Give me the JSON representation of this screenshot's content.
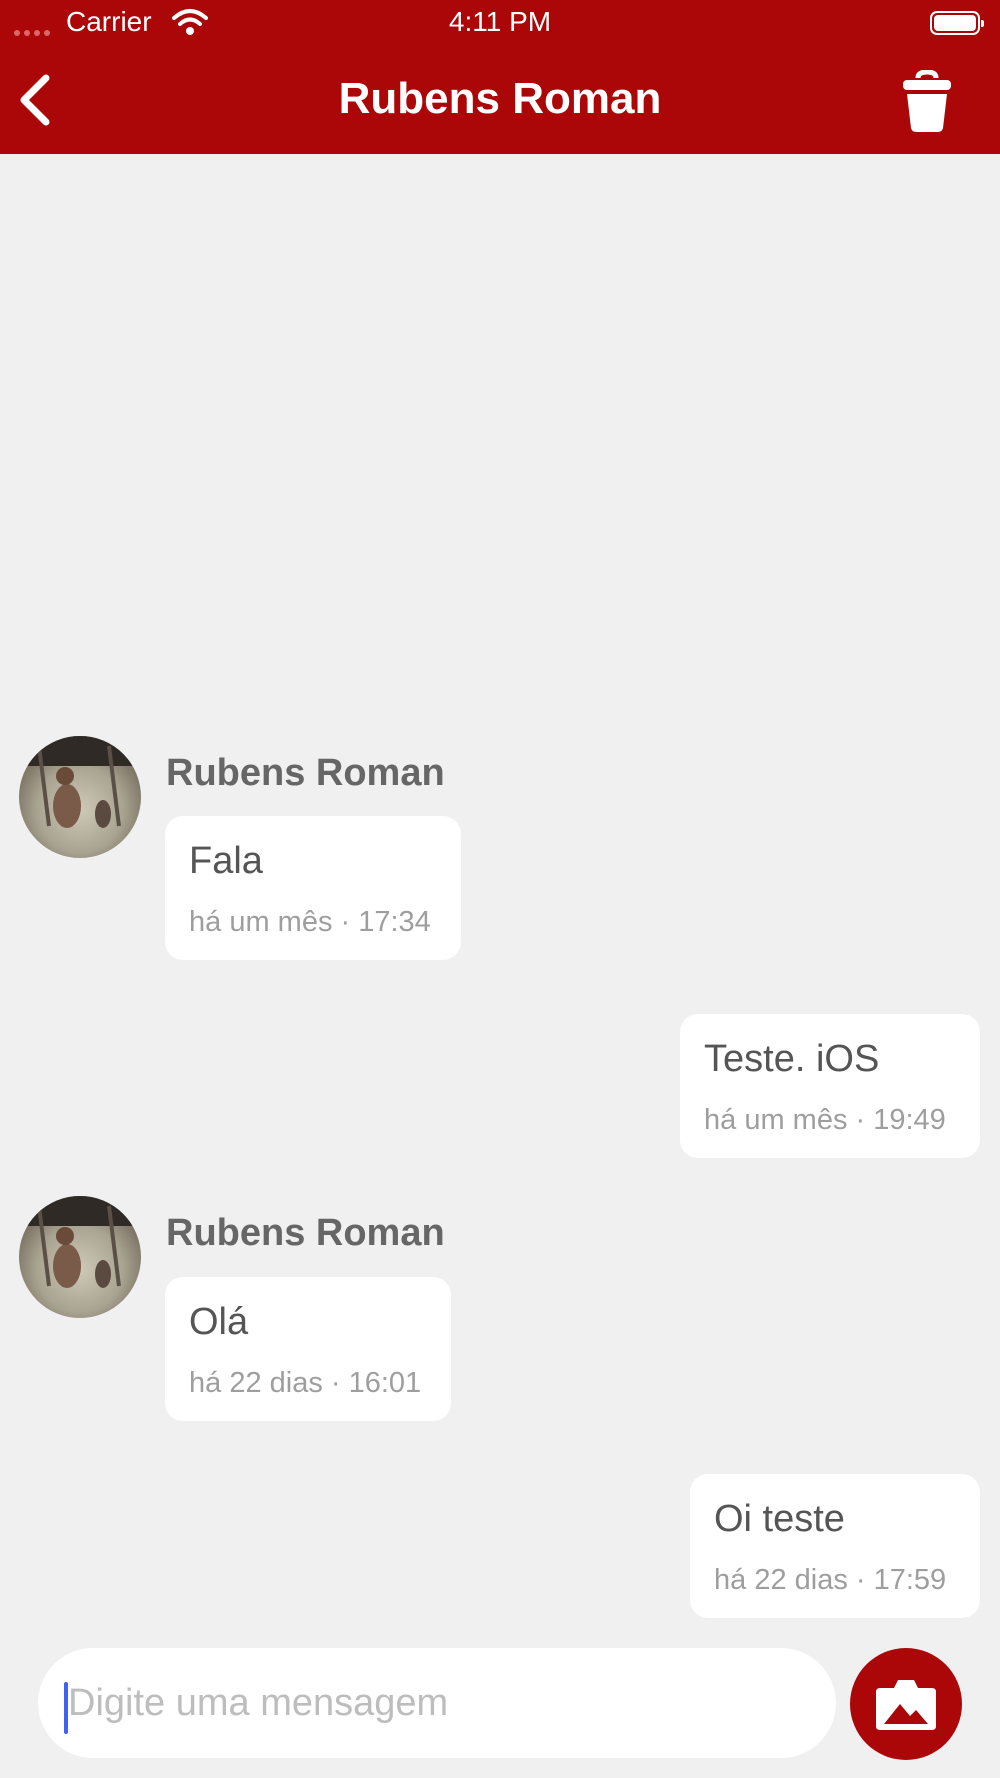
{
  "status_bar": {
    "carrier": "Carrier",
    "time": "4:11 PM"
  },
  "header": {
    "title": "Rubens Roman"
  },
  "messages": [
    {
      "direction": "incoming",
      "sender": "Rubens Roman",
      "text": "Fala",
      "meta": "há um mês · 17:34"
    },
    {
      "direction": "outgoing",
      "text": "Teste. iOS",
      "meta": "há um mês · 19:49"
    },
    {
      "direction": "incoming",
      "sender": "Rubens Roman",
      "text": "Olá",
      "meta": "há 22 dias · 16:01"
    },
    {
      "direction": "outgoing",
      "text": "Oi teste",
      "meta": "há 22 dias · 17:59"
    }
  ],
  "composer": {
    "placeholder": "Digite uma mensagem"
  },
  "icons": {
    "back": "chevron-left-icon",
    "delete": "trash-icon",
    "attach": "camera-icon"
  },
  "colors": {
    "accent": "#ab0709",
    "background": "#f0f0f0",
    "bubble": "#ffffff"
  }
}
